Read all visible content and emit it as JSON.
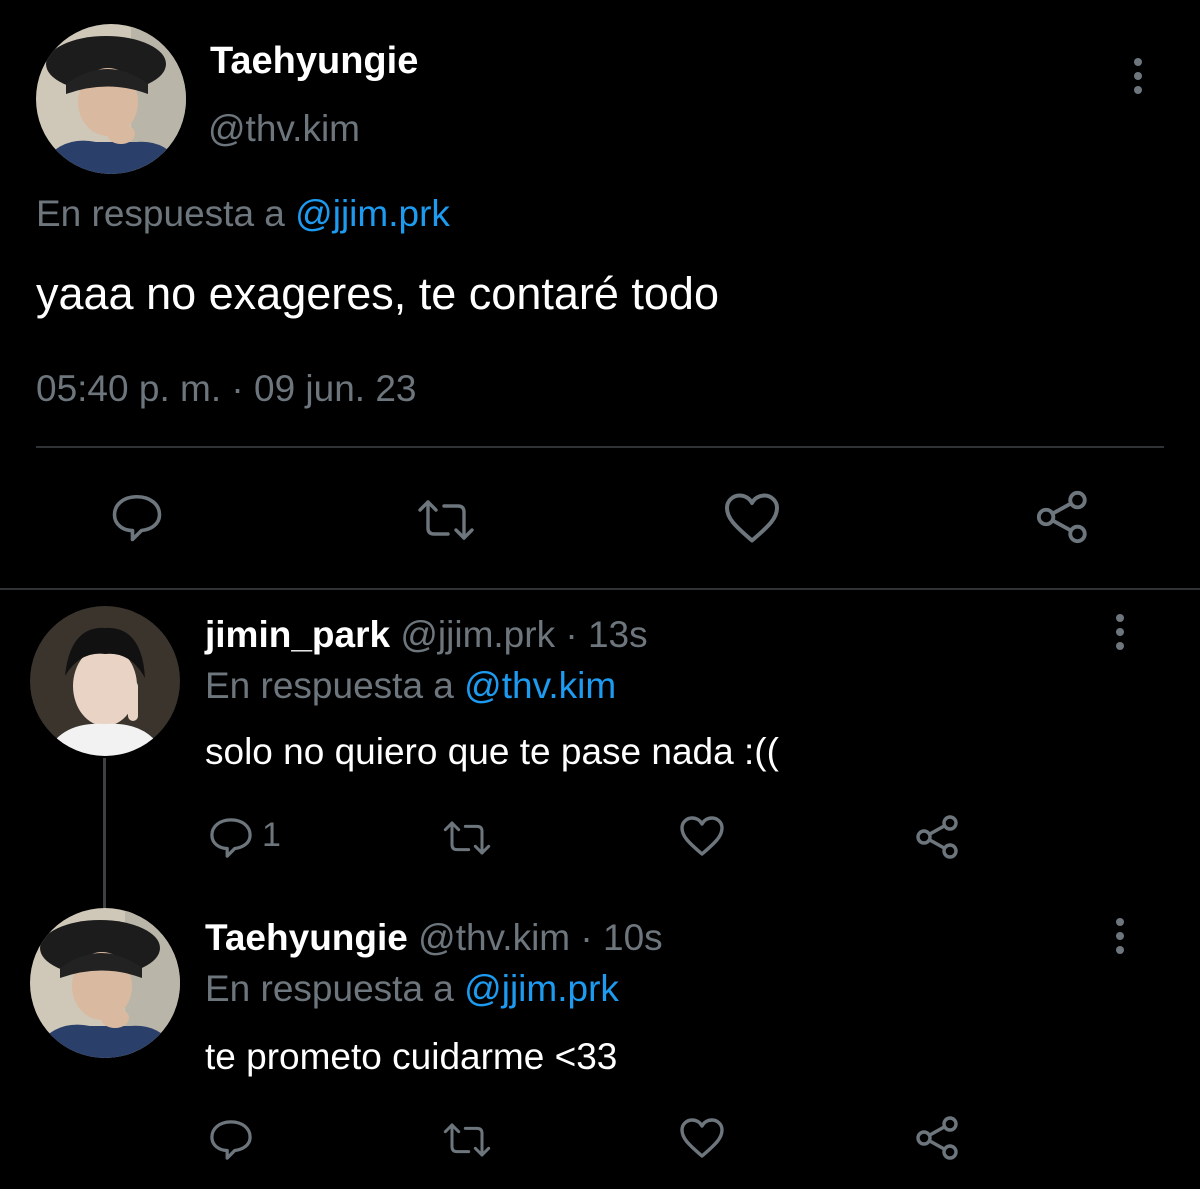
{
  "main_tweet": {
    "name": "Taehyungie",
    "handle": "@thv.kim",
    "reply_prefix": "En respuesta a",
    "reply_to": "@jjim.prk",
    "text": "yaaa no exageres, te contaré todo",
    "timestamp": "05:40 p. m. · 09 jun. 23"
  },
  "replies": [
    {
      "name": "jimin_park",
      "handle": "@jjim.prk",
      "time": "· 13s",
      "reply_prefix": "En respuesta a",
      "reply_to": "@thv.kim",
      "text": "solo no quiero que te pase nada :((",
      "reply_count": "1"
    },
    {
      "name": "Taehyungie",
      "handle": "@thv.kim",
      "time": "· 10s",
      "reply_prefix": "En respuesta a",
      "reply_to": "@jjim.prk",
      "text": "te prometo cuidarme <33"
    }
  ],
  "icons": [
    "reply-icon",
    "retweet-icon",
    "like-icon",
    "share-icon",
    "more-options-icon"
  ],
  "colors": {
    "background": "#000000",
    "text": "#ffffff",
    "muted": "#6e767d",
    "link": "#1d9bf0",
    "divider": "#2f3336"
  }
}
